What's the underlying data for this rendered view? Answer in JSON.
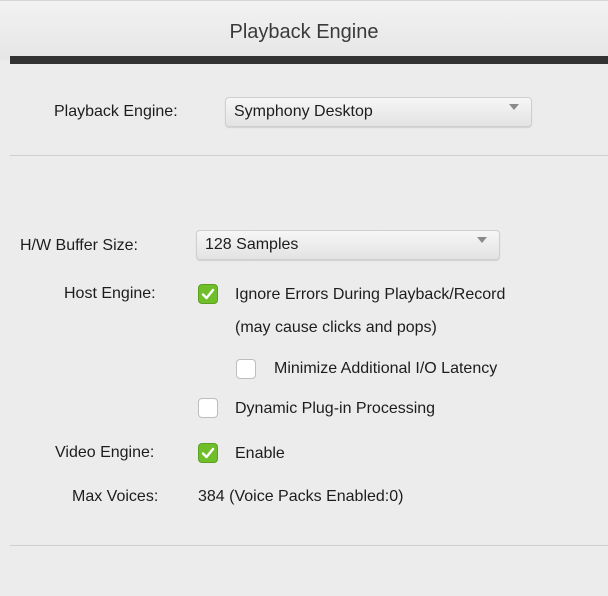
{
  "window": {
    "title": "Playback Engine"
  },
  "playback_engine": {
    "label": "Playback Engine:",
    "value": "Symphony Desktop"
  },
  "buffer": {
    "label": "H/W Buffer Size:",
    "value": "128 Samples"
  },
  "host_engine": {
    "label": "Host Engine:",
    "ignore_errors": {
      "label": "Ignore Errors During Playback/Record",
      "note": "(may cause clicks and pops)",
      "checked": true
    },
    "minimize_latency": {
      "label": "Minimize Additional I/O Latency",
      "checked": false
    },
    "dynamic_plugin": {
      "label": "Dynamic Plug-in Processing",
      "checked": false
    }
  },
  "video_engine": {
    "label": "Video Engine:",
    "enable": {
      "label": "Enable",
      "checked": true
    }
  },
  "max_voices": {
    "label": "Max Voices:",
    "value": "384 (Voice Packs Enabled:0)"
  },
  "colors": {
    "check_green": "#6fbe2a",
    "header_bar": "#333333",
    "background": "#ececec"
  },
  "icons": {
    "dropdown": "chevron-down-icon",
    "check": "checkmark-icon"
  }
}
